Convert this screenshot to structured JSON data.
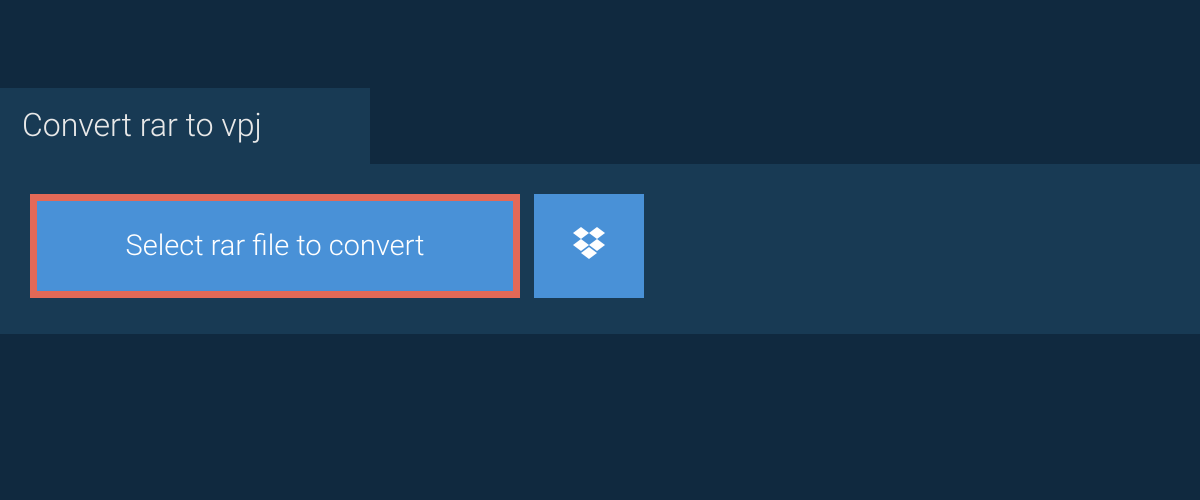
{
  "tab": {
    "title": "Convert rar to vpj"
  },
  "actions": {
    "select_label": "Select rar file to convert",
    "dropbox_icon": "dropbox-icon"
  },
  "colors": {
    "background": "#10293f",
    "panel": "#183a54",
    "accent": "#4991d7",
    "highlight_border": "#e36957",
    "text": "#e8e8e8"
  }
}
